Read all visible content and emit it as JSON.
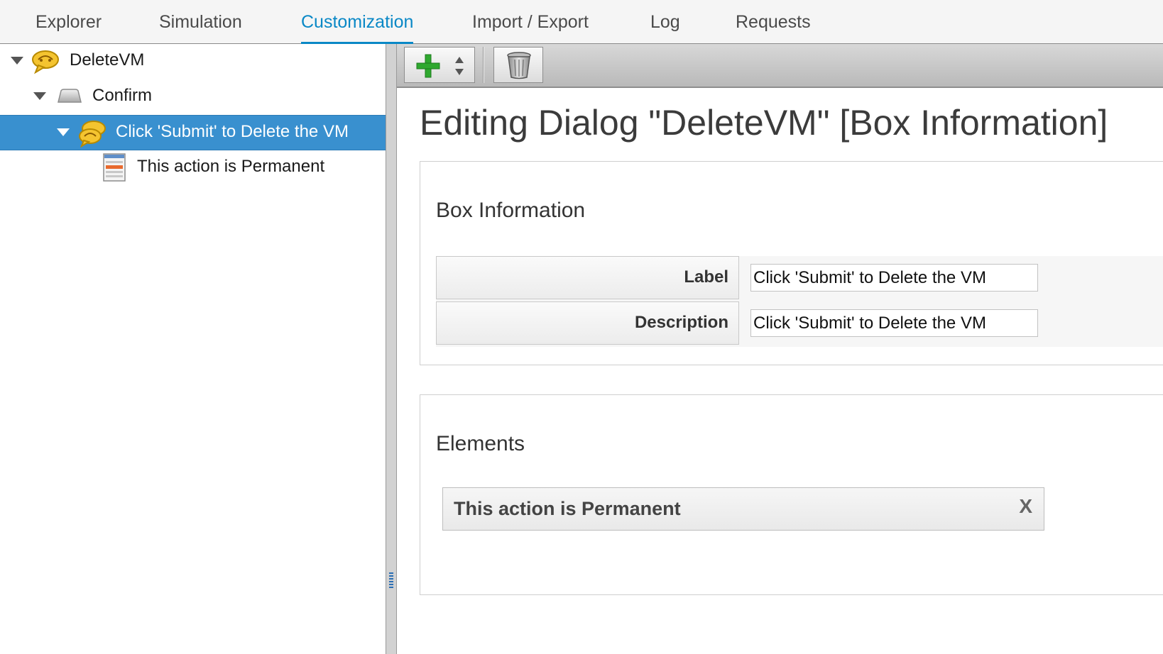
{
  "tabs": [
    {
      "label": "Explorer",
      "active": false
    },
    {
      "label": "Simulation",
      "active": false
    },
    {
      "label": "Customization",
      "active": true
    },
    {
      "label": "Import / Export",
      "active": false
    },
    {
      "label": "Log",
      "active": false
    },
    {
      "label": "Requests",
      "active": false
    }
  ],
  "tree": {
    "nodes": [
      {
        "label": "DeleteVM",
        "icon": "dialog-icon",
        "expanded": true
      },
      {
        "label": "Confirm",
        "icon": "tab-icon",
        "expanded": true
      },
      {
        "label": "Click 'Submit' to Delete the VM",
        "icon": "box-icon",
        "expanded": true,
        "selected": true
      },
      {
        "label": "This action is Permanent",
        "icon": "element-icon"
      }
    ]
  },
  "toolbar": {
    "add_icon": "plus-icon",
    "dropdown_icon": "up-down-arrows-icon",
    "delete_icon": "trash-icon"
  },
  "main": {
    "title": "Editing Dialog \"DeleteVM\" [Box Information]",
    "box_info": {
      "heading": "Box Information",
      "label_field": {
        "label": "Label",
        "value": "Click 'Submit' to Delete the VM"
      },
      "description_field": {
        "label": "Description",
        "value": "Click 'Submit' to Delete the VM"
      }
    },
    "elements": {
      "heading": "Elements",
      "items": [
        {
          "label": "This action is Permanent",
          "remove_glyph": "X"
        }
      ]
    }
  },
  "colors": {
    "accent": "#0a88c6",
    "selection": "#3990cf",
    "add_green": "#2fa82f"
  }
}
